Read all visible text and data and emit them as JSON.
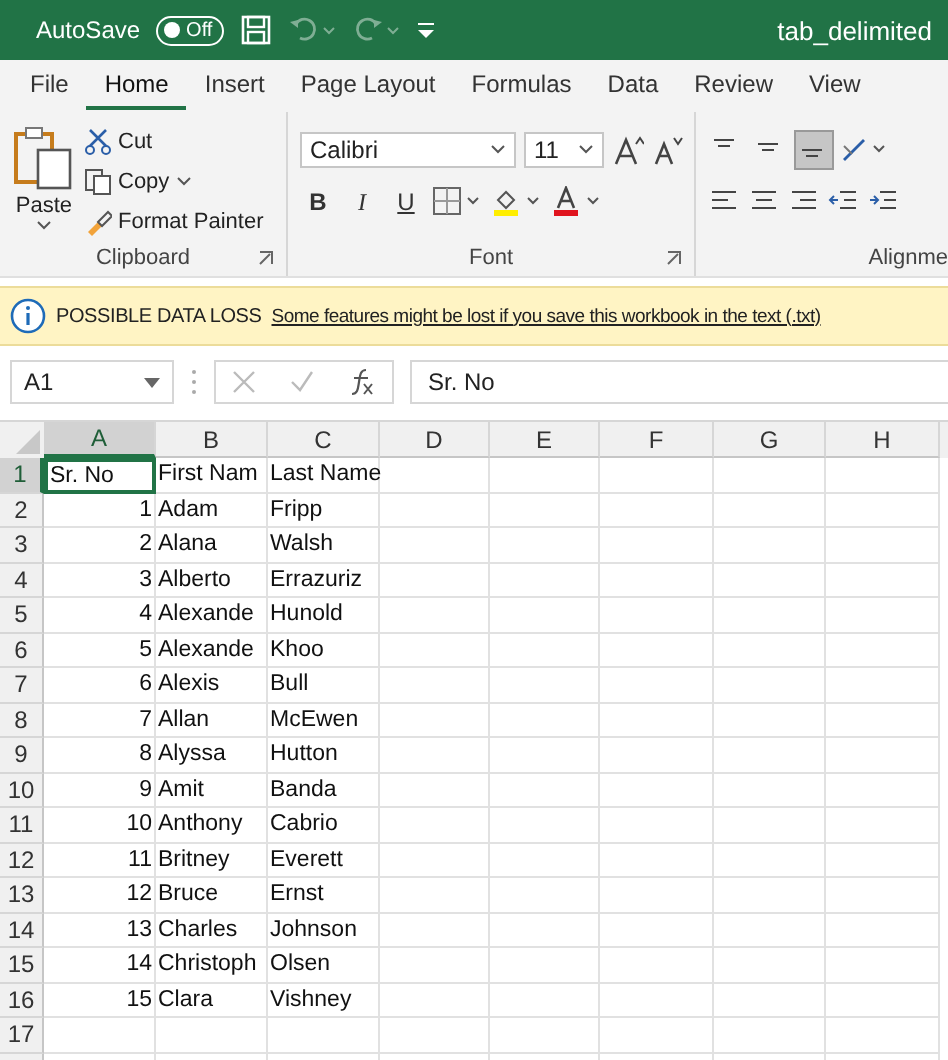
{
  "title_bar": {
    "autosave_label": "AutoSave",
    "autosave_toggle": {
      "label": "Off",
      "on": false
    },
    "title": "tab_delimited"
  },
  "tabs": [
    {
      "label": "File",
      "selected": false
    },
    {
      "label": "Home",
      "selected": true
    },
    {
      "label": "Insert",
      "selected": false
    },
    {
      "label": "Page Layout",
      "selected": false
    },
    {
      "label": "Formulas",
      "selected": false
    },
    {
      "label": "Data",
      "selected": false
    },
    {
      "label": "Review",
      "selected": false
    },
    {
      "label": "View",
      "selected": false
    }
  ],
  "ribbon": {
    "clipboard": {
      "paste": "Paste",
      "cut": "Cut",
      "copy": "Copy",
      "format_painter": "Format Painter",
      "label": "Clipboard"
    },
    "font": {
      "font_name": "Calibri",
      "font_size": "11",
      "bold": "B",
      "italic": "I",
      "underline": "U",
      "label": "Font"
    },
    "alignment": {
      "vertical_buttons": [
        {
          "selected": false
        },
        {
          "selected": false
        },
        {
          "selected": true
        }
      ],
      "label": "Alignme"
    }
  },
  "info_bar": {
    "title": "POSSIBLE DATA LOSS",
    "message": "Some features might be lost if you save this workbook in the text (.txt)"
  },
  "formula_bar": {
    "name_box": "A1",
    "value": "Sr. No"
  },
  "grid": {
    "columns": [
      {
        "label": "A",
        "selected": true
      },
      {
        "label": "B",
        "selected": false
      },
      {
        "label": "C",
        "selected": false
      },
      {
        "label": "D",
        "selected": false
      },
      {
        "label": "E",
        "selected": false
      },
      {
        "label": "F",
        "selected": false
      },
      {
        "label": "G",
        "selected": false
      },
      {
        "label": "H",
        "selected": false
      }
    ],
    "rows": [
      {
        "header": "1",
        "selected": true,
        "cells": [
          "Sr. No",
          "First Nam",
          "Last Name"
        ]
      },
      {
        "header": "2",
        "selected": false,
        "cells": [
          "1",
          "Adam",
          "Fripp"
        ]
      },
      {
        "header": "3",
        "selected": false,
        "cells": [
          "2",
          "Alana",
          "Walsh"
        ]
      },
      {
        "header": "4",
        "selected": false,
        "cells": [
          "3",
          "Alberto",
          "Errazuriz"
        ]
      },
      {
        "header": "5",
        "selected": false,
        "cells": [
          "4",
          "Alexande",
          "Hunold"
        ]
      },
      {
        "header": "6",
        "selected": false,
        "cells": [
          "5",
          "Alexande",
          "Khoo"
        ]
      },
      {
        "header": "7",
        "selected": false,
        "cells": [
          "6",
          "Alexis",
          "Bull"
        ]
      },
      {
        "header": "8",
        "selected": false,
        "cells": [
          "7",
          "Allan",
          "McEwen"
        ]
      },
      {
        "header": "9",
        "selected": false,
        "cells": [
          "8",
          "Alyssa",
          "Hutton"
        ]
      },
      {
        "header": "10",
        "selected": false,
        "cells": [
          "9",
          "Amit",
          "Banda"
        ]
      },
      {
        "header": "11",
        "selected": false,
        "cells": [
          "10",
          "Anthony",
          "Cabrio"
        ]
      },
      {
        "header": "12",
        "selected": false,
        "cells": [
          "11",
          "Britney",
          "Everett"
        ]
      },
      {
        "header": "13",
        "selected": false,
        "cells": [
          "12",
          "Bruce",
          "Ernst"
        ]
      },
      {
        "header": "14",
        "selected": false,
        "cells": [
          "13",
          "Charles",
          "Johnson"
        ]
      },
      {
        "header": "15",
        "selected": false,
        "cells": [
          "14",
          "Christoph",
          "Olsen"
        ]
      },
      {
        "header": "16",
        "selected": false,
        "cells": [
          "15",
          "Clara",
          "Vishney"
        ]
      },
      {
        "header": "17",
        "selected": false,
        "cells": []
      }
    ]
  }
}
